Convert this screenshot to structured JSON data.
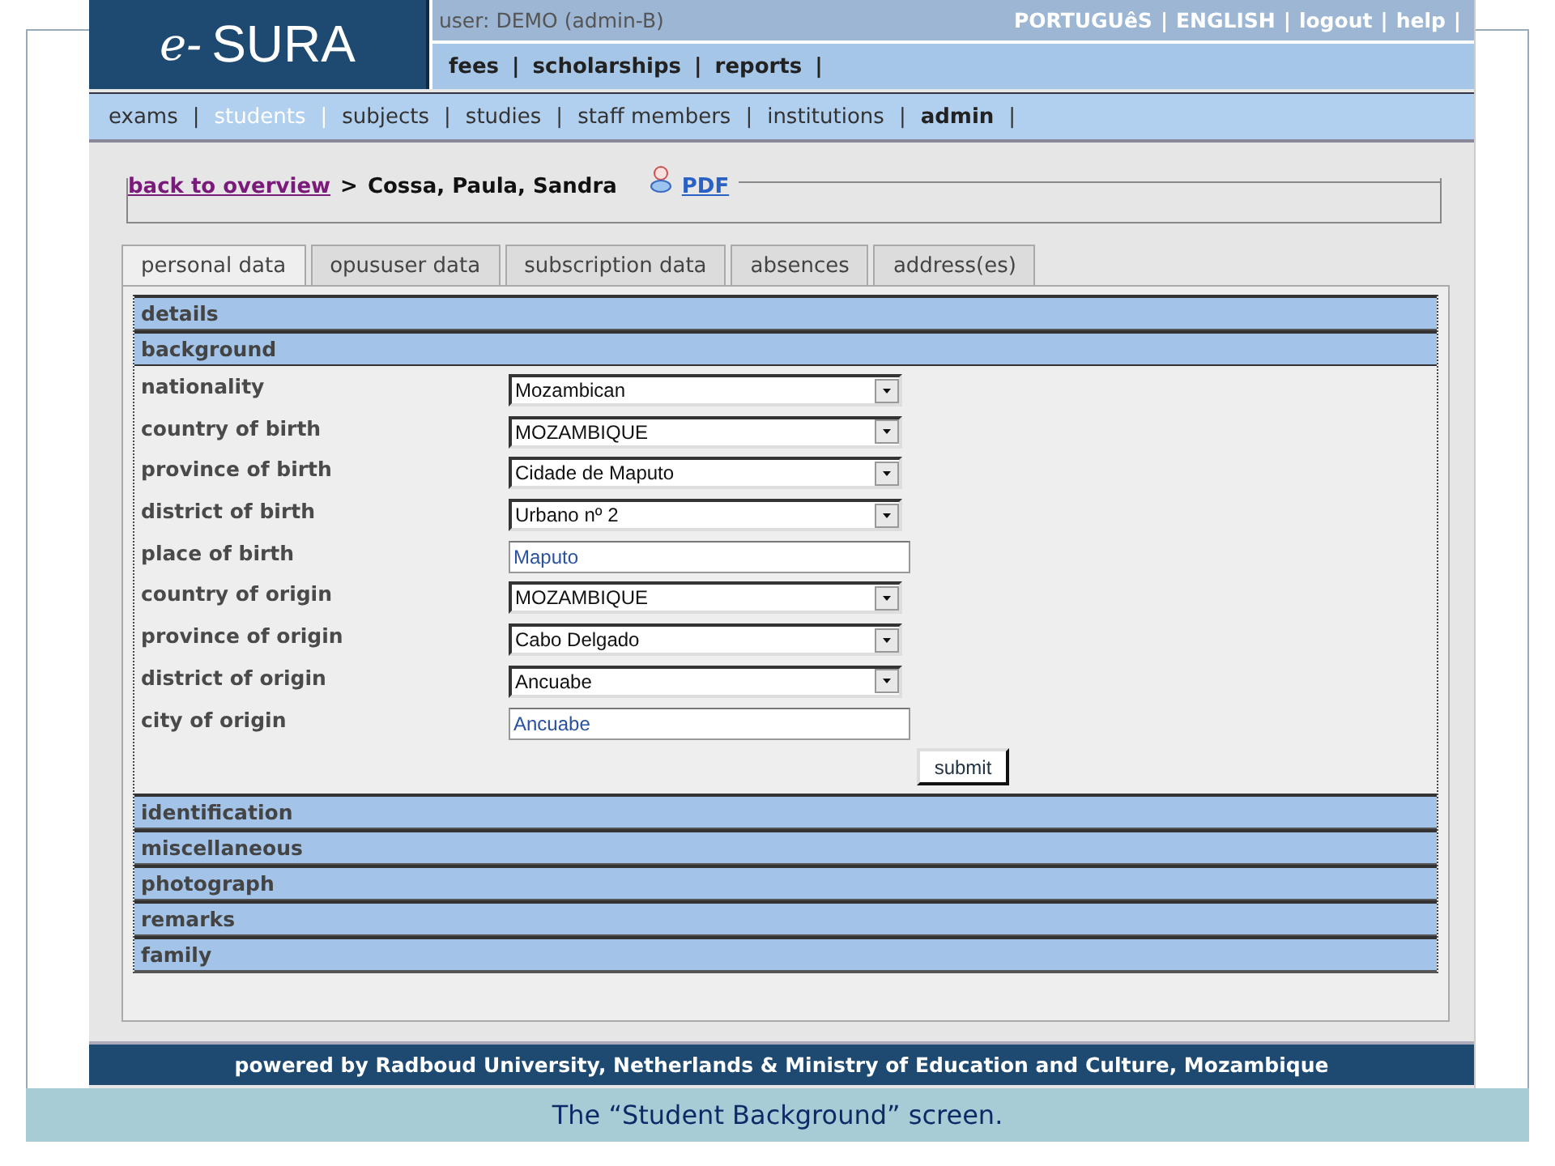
{
  "header": {
    "logo": {
      "prefix": "e-",
      "name": "SURA"
    },
    "user": "user: DEMO (admin-B)",
    "top_links": [
      "PORTUGUêS",
      "ENGLISH",
      "logout",
      "help"
    ],
    "nav": [
      "fees",
      "scholarships",
      "reports"
    ],
    "separator": "|"
  },
  "menu": {
    "separator": "|",
    "items": [
      {
        "label": "exams",
        "selected": false,
        "emphasized": false
      },
      {
        "label": "students",
        "selected": true,
        "emphasized": false
      },
      {
        "label": "subjects",
        "selected": false,
        "emphasized": false
      },
      {
        "label": "studies",
        "selected": false,
        "emphasized": false
      },
      {
        "label": "staff members",
        "selected": false,
        "emphasized": false
      },
      {
        "label": "institutions",
        "selected": false,
        "emphasized": false
      },
      {
        "label": "admin",
        "selected": false,
        "emphasized": true
      }
    ]
  },
  "breadcrumb": {
    "back_link": "back to overview",
    "separator": ">",
    "student": "Cossa, Paula, Sandra",
    "pdf_link": "PDF"
  },
  "tabs": [
    {
      "label": "personal data",
      "selected": true
    },
    {
      "label": "opususer data",
      "selected": false
    },
    {
      "label": "subscription data",
      "selected": false
    },
    {
      "label": "absences",
      "selected": false
    },
    {
      "label": "address(es)",
      "selected": false
    }
  ],
  "sections": [
    {
      "title": "details",
      "expanded": false
    },
    {
      "title": "background",
      "expanded": true,
      "fields": [
        {
          "label": "nationality",
          "kind": "select",
          "value": "Mozambican"
        },
        {
          "label": "country of birth",
          "kind": "select",
          "value": "MOZAMBIQUE"
        },
        {
          "label": "province of birth",
          "kind": "select",
          "value": "Cidade de Maputo"
        },
        {
          "label": "district of birth",
          "kind": "select",
          "value": "Urbano nº 2"
        },
        {
          "label": "place of birth",
          "kind": "text",
          "value": "Maputo"
        },
        {
          "label": "country of origin",
          "kind": "select",
          "value": "MOZAMBIQUE"
        },
        {
          "label": "province of origin",
          "kind": "select",
          "value": "Cabo Delgado"
        },
        {
          "label": "district of origin",
          "kind": "select",
          "value": "Ancuabe"
        },
        {
          "label": "city of origin",
          "kind": "text",
          "value": "Ancuabe"
        }
      ],
      "submit": "submit"
    },
    {
      "title": "identification",
      "expanded": false
    },
    {
      "title": "miscellaneous",
      "expanded": false
    },
    {
      "title": "photograph",
      "expanded": false
    },
    {
      "title": "remarks",
      "expanded": false
    },
    {
      "title": "family",
      "expanded": false
    }
  ],
  "footer": "powered by Radboud University, Netherlands & Ministry of Education and Culture, Mozambique",
  "caption": "The “Student Background” screen."
}
